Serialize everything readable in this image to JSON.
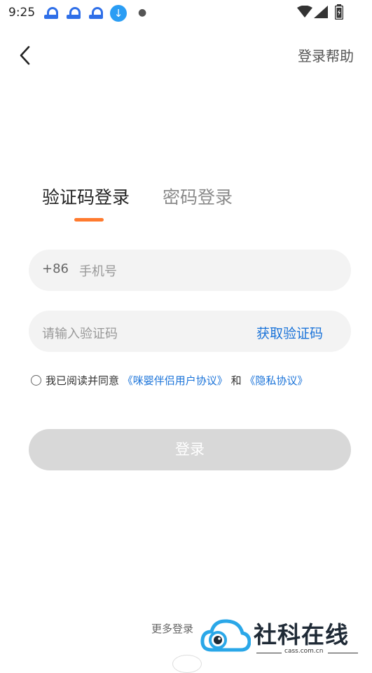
{
  "status_bar": {
    "time": "9:25",
    "notification_icons": [
      "cloud-app-icon",
      "cloud-app-icon",
      "cloud-app-icon",
      "download-icon",
      "more-dot-icon"
    ],
    "system_icons": [
      "wifi-icon",
      "signal-icon",
      "battery-icon"
    ]
  },
  "header": {
    "back_icon": "chevron-left-icon",
    "help_label": "登录帮助"
  },
  "tabs": [
    {
      "label": "验证码登录",
      "active": true
    },
    {
      "label": "密码登录",
      "active": false
    }
  ],
  "form": {
    "country_code": "+86",
    "phone_placeholder": "手机号",
    "code_placeholder": "请输入验证码",
    "get_code_label": "获取验证码"
  },
  "agreement": {
    "prefix": "我已阅读并同意",
    "user_agreement": "《咪婴伴侣用户协议》",
    "connector": "和",
    "privacy_policy": "《隐私协议》",
    "checked": false
  },
  "login_button_label": "登录",
  "more_login_label": "更多登录",
  "watermark": {
    "title": "社科在线",
    "url": "cass.com.cn"
  },
  "colors": {
    "accent_orange": "#ff7a2e",
    "link_blue": "#1a73d9",
    "field_bg": "#f3f3f3",
    "button_disabled": "#d8d8d8",
    "status_icon_blue": "#2f6fe8"
  }
}
